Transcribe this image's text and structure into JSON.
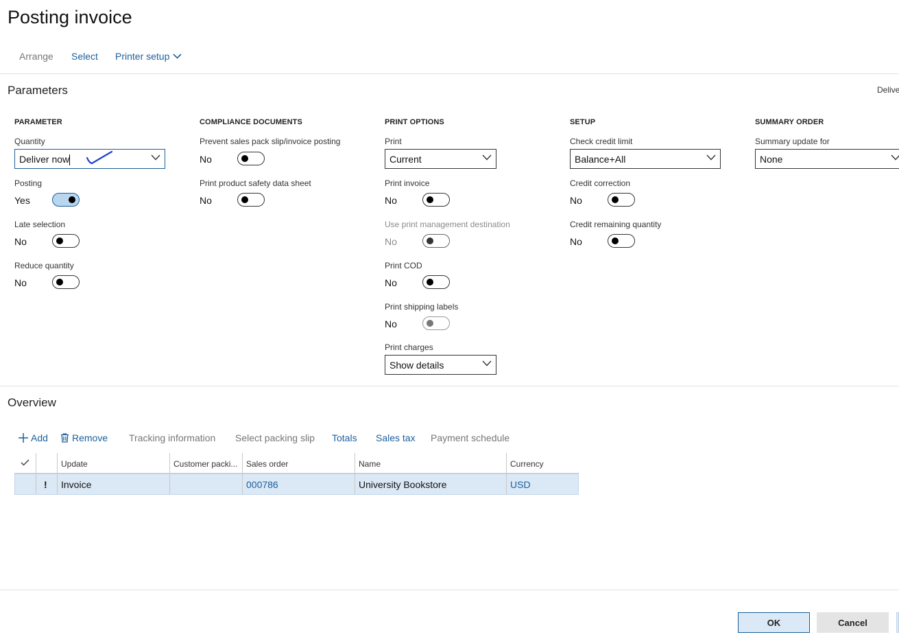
{
  "page": {
    "title": "Posting invoice"
  },
  "action_pane": {
    "arrange": "Arrange",
    "select": "Select",
    "printer_setup": "Printer setup"
  },
  "parameters": {
    "section_title": "Parameters",
    "cutoff_text": "Delive",
    "parameter_group": {
      "header": "PARAMETER",
      "quantity_label": "Quantity",
      "quantity_value": "Deliver now",
      "posting_label": "Posting",
      "posting_value": "Yes",
      "late_selection_label": "Late selection",
      "late_selection_value": "No",
      "reduce_quantity_label": "Reduce quantity",
      "reduce_quantity_value": "No"
    },
    "compliance_group": {
      "header": "COMPLIANCE DOCUMENTS",
      "prevent_label": "Prevent sales pack slip/invoice posting",
      "prevent_value": "No",
      "safety_label": "Print product safety data sheet",
      "safety_value": "No"
    },
    "print_options_group": {
      "header": "PRINT OPTIONS",
      "print_label": "Print",
      "print_value": "Current",
      "print_invoice_label": "Print invoice",
      "print_invoice_value": "No",
      "use_print_mgmt_label": "Use print management destination",
      "use_print_mgmt_value": "No",
      "print_cod_label": "Print COD",
      "print_cod_value": "No",
      "print_shipping_label": "Print shipping labels",
      "print_shipping_value": "No",
      "print_charges_label": "Print charges",
      "print_charges_value": "Show details"
    },
    "setup_group": {
      "header": "SETUP",
      "check_credit_label": "Check credit limit",
      "check_credit_value": "Balance+All",
      "credit_correction_label": "Credit correction",
      "credit_correction_value": "No",
      "credit_remaining_label": "Credit remaining quantity",
      "credit_remaining_value": "No"
    },
    "summary_group": {
      "header": "SUMMARY ORDER",
      "summary_update_label": "Summary update for",
      "summary_update_value": "None"
    }
  },
  "overview": {
    "section_title": "Overview",
    "toolbar": {
      "add": "Add",
      "remove": "Remove",
      "tracking": "Tracking information",
      "select_packing_slip": "Select packing slip",
      "totals": "Totals",
      "sales_tax": "Sales tax",
      "payment_schedule": "Payment schedule"
    },
    "grid": {
      "columns": {
        "update": "Update",
        "customer_packing": "Customer packi...",
        "sales_order": "Sales order",
        "name": "Name",
        "currency": "Currency"
      },
      "rows": [
        {
          "flag": "!",
          "update": "Invoice",
          "customer_packing": "",
          "sales_order": "000786",
          "name": "University Bookstore",
          "currency": "USD"
        }
      ]
    }
  },
  "footer": {
    "ok": "OK",
    "cancel": "Cancel"
  },
  "colors": {
    "link": "#1a5f9c",
    "selected_row": "#dbe8f5",
    "scribble": "#1f3fd1"
  }
}
